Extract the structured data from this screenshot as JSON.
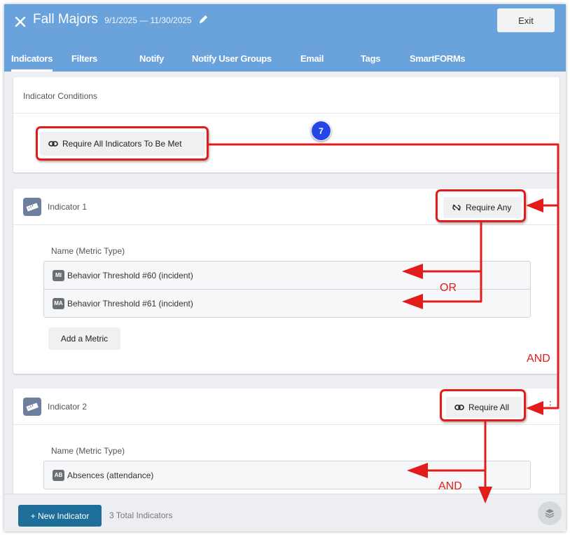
{
  "header": {
    "title": "Fall Majors",
    "dates": "9/1/2025 — 11/30/2025",
    "exit_label": "Exit"
  },
  "tabs": [
    "Indicators",
    "Filters",
    "Notify",
    "Notify User Groups",
    "Email",
    "Tags",
    "SmartFORMs"
  ],
  "active_tab": "Indicators",
  "conditions": {
    "title": "Indicator Conditions",
    "button_label": "Require All Indicators To Be Met"
  },
  "indicator1": {
    "title": "Indicator 1",
    "require_label": "Require Any",
    "column_header": "Name (Metric Type)",
    "metrics": [
      {
        "badge": "MI",
        "name": "Behavior Threshold #60 (incident)"
      },
      {
        "badge": "MA",
        "name": "Behavior Threshold #61 (incident)"
      }
    ],
    "add_metric_label": "Add a Metric"
  },
  "indicator2": {
    "title": "Indicator 2",
    "require_label": "Require All",
    "column_header": "Name (Metric Type)",
    "metrics": [
      {
        "badge": "AB",
        "name": "Absences (attendance)"
      }
    ]
  },
  "footer": {
    "new_indicator_label": "+ New Indicator",
    "total_text": "3 Total Indicators"
  },
  "annotations": {
    "step_number": "7",
    "or_label": "OR",
    "and_label_right": "AND",
    "and_label_bottom": "AND",
    "color": "#e21b1b"
  },
  "colors": {
    "header": "#6aa2dc",
    "primary_button": "#1e6e9a",
    "step_badge": "#2446e8"
  }
}
